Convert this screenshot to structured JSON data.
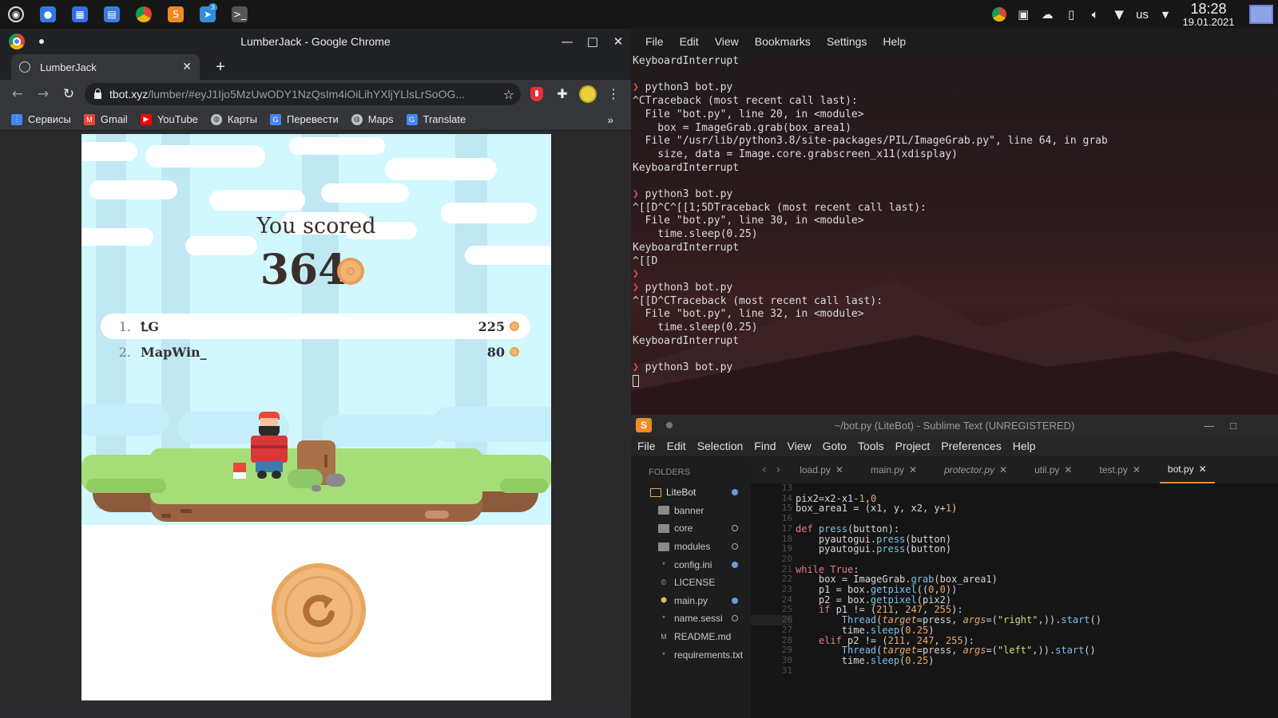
{
  "taskbar": {
    "apps": [
      {
        "icon": "system-menu-icon",
        "color": "#3c3c3c"
      },
      {
        "icon": "messenger-icon",
        "color": "#2f7be0"
      },
      {
        "icon": "calendar-icon",
        "color": "#2f6ee0"
      },
      {
        "icon": "files-icon",
        "color": "#3a7be0"
      },
      {
        "icon": "chrome-icon",
        "color": "#db4437"
      },
      {
        "icon": "sublime-icon",
        "color": "#f08a24"
      },
      {
        "icon": "telegram-icon",
        "color": "#2f8fd8",
        "badge": "3"
      },
      {
        "icon": "terminal-icon",
        "color": "#555555"
      }
    ],
    "tray": {
      "lang": "us",
      "time": "18:28",
      "date": "19.01.2021"
    }
  },
  "chrome": {
    "window_title": "LumberJack - Google Chrome",
    "tab_title": "LumberJack",
    "url_host": "tbot.xyz",
    "url_path": "/lumber/#eyJ1Ijo5MzUwODY1NzQsIm4iOiLihYXljYLlsLrSoOG...",
    "bookmarks": [
      {
        "label": "Сервисы",
        "icon": "apps-icon",
        "color": "#4285f4"
      },
      {
        "label": "Gmail",
        "icon": "gmail-icon",
        "color": "#ea4335"
      },
      {
        "label": "YouTube",
        "icon": "youtube-icon",
        "color": "#ff0000"
      },
      {
        "label": "Карты",
        "icon": "globe-icon",
        "color": "#5f6368"
      },
      {
        "label": "Перевести",
        "icon": "translate-icon",
        "color": "#4285f4"
      },
      {
        "label": "Maps",
        "icon": "globe-icon",
        "color": "#5f6368"
      },
      {
        "label": "Translate",
        "icon": "translate-icon",
        "color": "#4285f4"
      }
    ],
    "bookmarks_more": "»"
  },
  "game": {
    "heading": "You scored",
    "score": "364",
    "leaderboard": [
      {
        "rank": "1.",
        "name": "ꝈG",
        "score": "225"
      },
      {
        "rank": "2.",
        "name": "MapWin_",
        "score": "80"
      }
    ]
  },
  "konsole": {
    "menu": [
      "File",
      "Edit",
      "View",
      "Bookmarks",
      "Settings",
      "Help"
    ],
    "lines": [
      {
        "t": "KeyboardInterrupt"
      },
      {
        "t": ""
      },
      {
        "p": "❯ ",
        "t": "python3 bot.py"
      },
      {
        "t": "^CTraceback (most recent call last):"
      },
      {
        "t": "  File \"bot.py\", line 20, in <module>"
      },
      {
        "t": "    box = ImageGrab.grab(box_area1)"
      },
      {
        "t": "  File \"/usr/lib/python3.8/site-packages/PIL/ImageGrab.py\", line 64, in grab"
      },
      {
        "t": "    size, data = Image.core.grabscreen_x11(xdisplay)"
      },
      {
        "t": "KeyboardInterrupt"
      },
      {
        "t": ""
      },
      {
        "p": "❯ ",
        "t": "python3 bot.py"
      },
      {
        "t": "^[[D^C^[[1;5DTraceback (most recent call last):"
      },
      {
        "t": "  File \"bot.py\", line 30, in <module>"
      },
      {
        "t": "    time.sleep(0.25)"
      },
      {
        "t": "KeyboardInterrupt"
      },
      {
        "t": "^[[D"
      },
      {
        "p": "❯",
        "t": ""
      },
      {
        "p": "❯ ",
        "t": "python3 bot.py"
      },
      {
        "t": "^[[D^CTraceback (most recent call last):"
      },
      {
        "t": "  File \"bot.py\", line 32, in <module>"
      },
      {
        "t": "    time.sleep(0.25)"
      },
      {
        "t": "KeyboardInterrupt"
      },
      {
        "t": ""
      },
      {
        "p": "❯ ",
        "t": "python3 bot.py"
      }
    ]
  },
  "sublime": {
    "window_title": "~/bot.py (LiteBot) - Sublime Text (UNREGISTERED)",
    "menu": [
      "File",
      "Edit",
      "Selection",
      "Find",
      "View",
      "Goto",
      "Tools",
      "Project",
      "Preferences",
      "Help"
    ],
    "folders_header": "FOLDERS",
    "sidebar": [
      {
        "label": "LiteBot",
        "kind": "root",
        "mark": "dot"
      },
      {
        "label": "banner",
        "kind": "folder",
        "mark": ""
      },
      {
        "label": "core",
        "kind": "folder",
        "mark": "ring"
      },
      {
        "label": "modules",
        "kind": "folder",
        "mark": "ring"
      },
      {
        "label": "config.ini",
        "kind": "file",
        "mark": "dot"
      },
      {
        "label": "LICENSE",
        "kind": "file",
        "mark": ""
      },
      {
        "label": "main.py",
        "kind": "file",
        "mark": "dot"
      },
      {
        "label": "name.sessi",
        "kind": "file",
        "mark": "ring"
      },
      {
        "label": "README.md",
        "kind": "file",
        "mark": ""
      },
      {
        "label": "requirements.txt",
        "kind": "file",
        "mark": ""
      }
    ],
    "tabs": [
      "load.py",
      "main.py",
      "protector.py",
      "util.py",
      "test.py",
      "bot.py"
    ],
    "active_tab": "bot.py",
    "gutter": [
      "13",
      "14",
      "15",
      "16",
      "17",
      "18",
      "19",
      "20",
      "21",
      "22",
      "23",
      "24",
      "25",
      "26",
      "27",
      "28",
      "29",
      "30",
      "31"
    ],
    "code": [
      "",
      "pix2=x2-x1-1,0",
      "box_area1 = (x1, y, x2, y+1)",
      "",
      "def press(button):",
      "    pyautogui.press(button)",
      "    pyautogui.press(button)",
      "",
      "while True:",
      "    box = ImageGrab.grab(box_area1)",
      "    p1 = box.getpixel((0,0))",
      "    p2 = box.getpixel(pix2)",
      "    if p1 != (211, 247, 255):",
      "        Thread(target=press, args=(\"right\",)).start()",
      "        time.sleep(0.25)",
      "    elif p2 != (211, 247, 255):",
      "        Thread(target=press, args=(\"left\",)).start()",
      "        time.sleep(0.25)",
      ""
    ]
  }
}
